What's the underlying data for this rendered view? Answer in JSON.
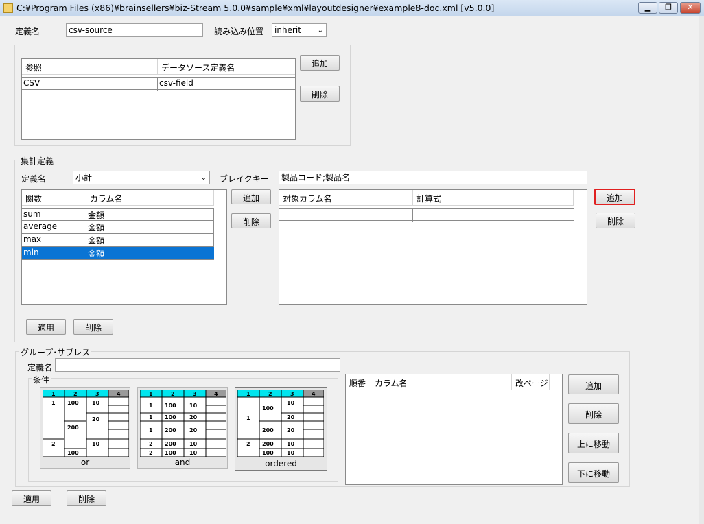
{
  "window": {
    "title": "C:¥Program Files (x86)¥brainsellers¥biz-Stream 5.0.0¥sample¥xml¥layoutdesigner¥example8-doc.xml [v5.0.0]",
    "btn_min": "▁",
    "btn_max": "❐",
    "btn_close": "✕"
  },
  "top": {
    "name_label": "定義名",
    "name_value": "csv-source",
    "read_label": "読み込み位置",
    "read_value": "inherit"
  },
  "ref": {
    "col1": "参照",
    "col2": "データソース定義名",
    "rows": [
      {
        "c1": "CSV",
        "c2": "csv-field"
      }
    ],
    "add": "追加",
    "del": "削除"
  },
  "agg": {
    "group_title": "集計定義",
    "name_label": "定義名",
    "name_value": "小計",
    "break_label": "ブレイクキー",
    "break_value": "製品コード;製品名",
    "fcol1": "関数",
    "fcol2": "カラム名",
    "frows": [
      {
        "c1": "sum",
        "c2": "金額"
      },
      {
        "c1": "average",
        "c2": "金額"
      },
      {
        "c1": "max",
        "c2": "金額"
      },
      {
        "c1": "min",
        "c2": "金額"
      }
    ],
    "fadd": "追加",
    "fdel": "削除",
    "tcol1": "対象カラム名",
    "tcol2": "計算式",
    "tadd": "追加",
    "tdel": "削除",
    "apply": "適用",
    "delete": "削除"
  },
  "gs": {
    "group_title": "グループ･サプレス",
    "name_label": "定義名",
    "name_value": "",
    "cond_label": "条件",
    "thumbs": [
      {
        "caption": "or"
      },
      {
        "caption": "and"
      },
      {
        "caption": "ordered"
      }
    ],
    "header_nums": [
      "1",
      "2",
      "3",
      "4"
    ],
    "col_order": "順番",
    "col_name": "カラム名",
    "col_page": "改ページ",
    "add": "追加",
    "del": "削除",
    "up": "上に移動",
    "down": "下に移動"
  },
  "bottom": {
    "apply": "適用",
    "delete": "削除"
  },
  "colors": {
    "selection": "#0a74d4",
    "highlight_border": "#e02020",
    "thumb_header": "#00e5ee"
  }
}
